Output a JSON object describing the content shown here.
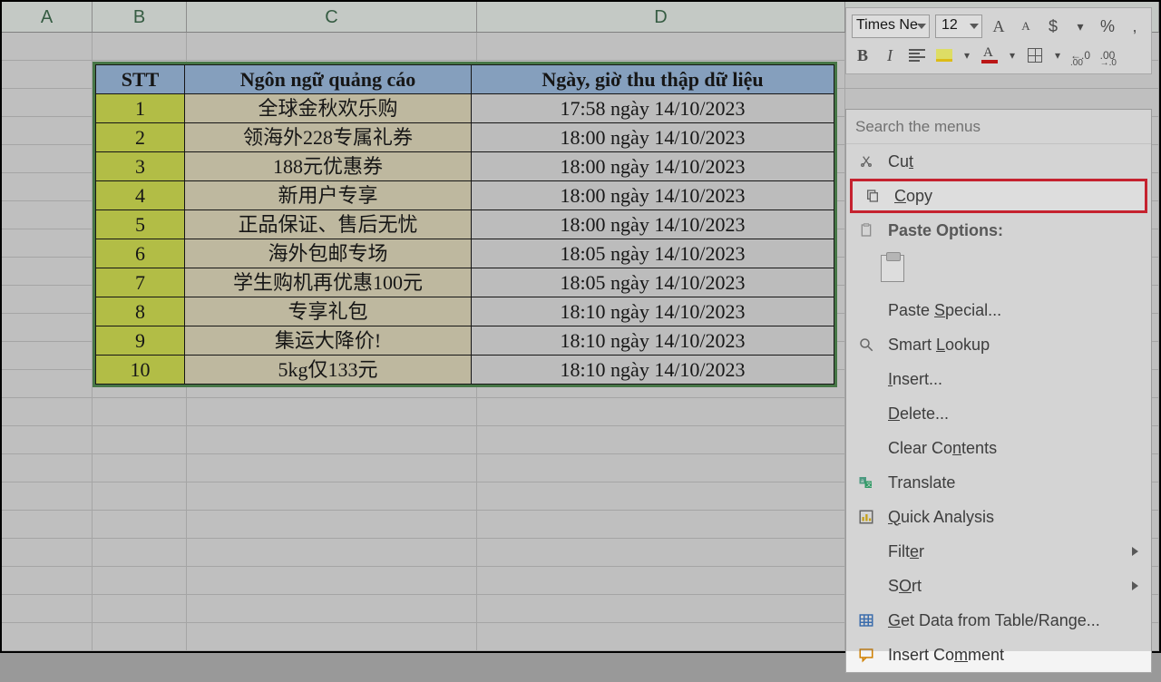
{
  "columns": {
    "A": "A",
    "B": "B",
    "C": "C",
    "D": "D"
  },
  "table": {
    "headers": {
      "stt": "STT",
      "lang": "Ngôn ngữ quảng cáo",
      "date": "Ngày, giờ thu thập dữ liệu"
    },
    "rows": [
      {
        "stt": "1",
        "lang": "全球金秋欢乐购",
        "date": "17:58 ngày 14/10/2023"
      },
      {
        "stt": "2",
        "lang": "领海外228专属礼券",
        "date": "18:00 ngày 14/10/2023"
      },
      {
        "stt": "3",
        "lang": "188元优惠券",
        "date": "18:00 ngày 14/10/2023"
      },
      {
        "stt": "4",
        "lang": "新用户专享",
        "date": "18:00 ngày 14/10/2023"
      },
      {
        "stt": "5",
        "lang": "正品保证、售后无忧",
        "date": "18:00 ngày 14/10/2023"
      },
      {
        "stt": "6",
        "lang": "海外包邮专场",
        "date": "18:05 ngày 14/10/2023"
      },
      {
        "stt": "7",
        "lang": "学生购机再优惠100元",
        "date": "18:05 ngày 14/10/2023"
      },
      {
        "stt": "8",
        "lang": "专享礼包",
        "date": "18:10 ngày 14/10/2023"
      },
      {
        "stt": "9",
        "lang": "集运大降价!",
        "date": "18:10 ngày 14/10/2023"
      },
      {
        "stt": "10",
        "lang": "5kg仅133元",
        "date": "18:10 ngày 14/10/2023"
      }
    ]
  },
  "miniToolbar": {
    "font": "Times Ne",
    "size": "12",
    "grow": "A",
    "shrink": "A",
    "currency": "$",
    "percent": "%",
    "comma": ",",
    "bold": "B",
    "italic": "I",
    "incDec": ".0",
    "decInc": ".00"
  },
  "contextMenu": {
    "searchPlaceholder": "Search the menus",
    "cut": "Cut",
    "cutKey": "t",
    "copy": "Copy",
    "copyKey": "C",
    "pasteOptions": "Paste Options:",
    "pasteSpecial": "Paste Special...",
    "pasteSpecialKey": "S",
    "smartLookup": "Smart Lookup",
    "smartLookupKey": "L",
    "insert": "Insert...",
    "insertKey": "I",
    "delete": "Delete...",
    "deleteKey": "D",
    "clear": "Clear Contents",
    "clearKey": "n",
    "translate": "Translate",
    "quickAnalysis": "Quick Analysis",
    "quickAnalysisKey": "Q",
    "filter": "Filter",
    "filterKey": "e",
    "sort": "Sort",
    "sortKey": "O",
    "getData": "Get Data from Table/Range...",
    "getDataKey": "G",
    "insertComment": "Insert Comment",
    "insertCommentKey": "m"
  }
}
